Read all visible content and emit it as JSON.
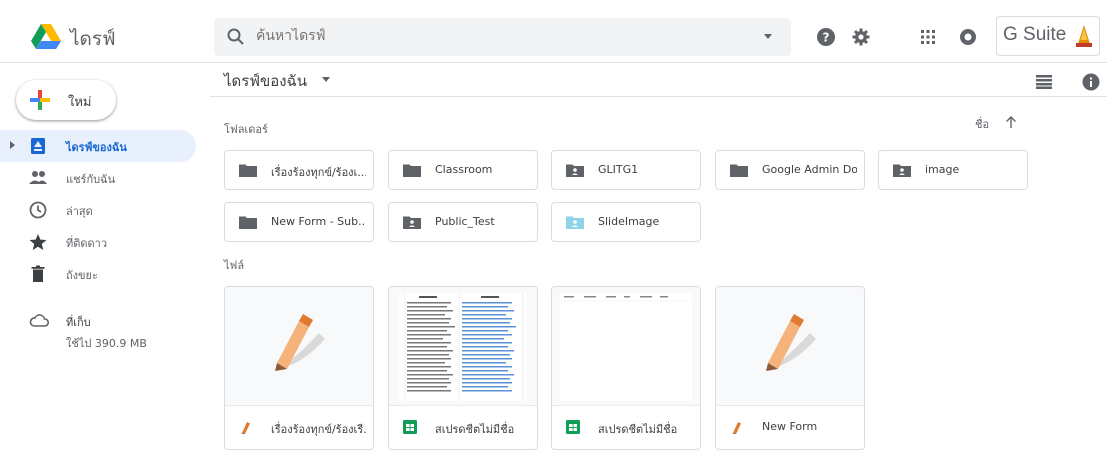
{
  "app": {
    "title": "ไดรฟ์"
  },
  "search": {
    "placeholder": "ค้นหาไดรฟ์"
  },
  "header": {
    "gsuite_label": "G Suite"
  },
  "new_button": {
    "label": "ใหม่"
  },
  "sidebar": {
    "items": [
      {
        "label": "ไดรฟ์ของฉัน",
        "icon": "my-drive-icon",
        "active": true
      },
      {
        "label": "แชร์กับฉัน",
        "icon": "shared-icon"
      },
      {
        "label": "ล่าสุด",
        "icon": "clock-icon"
      },
      {
        "label": "ที่ติดดาว",
        "icon": "star-icon"
      },
      {
        "label": "ถังขยะ",
        "icon": "trash-icon"
      }
    ],
    "storage": {
      "label": "ที่เก็บ",
      "used": "ใช้ไป 390.9 MB",
      "icon": "cloud-icon"
    }
  },
  "main": {
    "breadcrumb": "ไดรฟ์ของฉัน",
    "folders_heading": "โฟลเดอร์",
    "files_heading": "ไฟล์",
    "sort_label": "ชื่อ",
    "folders": [
      {
        "name": "เรื่องร้องทุกข์/ร้องเ...",
        "type": "folder"
      },
      {
        "name": "Classroom",
        "type": "folder"
      },
      {
        "name": "GLITG1",
        "type": "shared-folder"
      },
      {
        "name": "Google Admin Do...",
        "type": "folder"
      },
      {
        "name": "image",
        "type": "shared-folder"
      },
      {
        "name": "New Form - Sub...",
        "type": "folder"
      },
      {
        "name": "Public_Test",
        "type": "shared-folder"
      },
      {
        "name": "SlideImage",
        "type": "shared-folder-light"
      }
    ],
    "files": [
      {
        "name": "เรื่องร้องทุกข์/ร้องเรี...",
        "type": "form"
      },
      {
        "name": "สเปรดชีตไม่มีชื่อ",
        "type": "sheet"
      },
      {
        "name": "สเปรดชีตไม่มีชื่อ",
        "type": "sheet"
      },
      {
        "name": "New Form",
        "type": "form"
      }
    ]
  },
  "colors": {
    "accent": "#1967d2",
    "active_bg": "#e8f0fe",
    "sheet_green": "#0f9d58"
  }
}
